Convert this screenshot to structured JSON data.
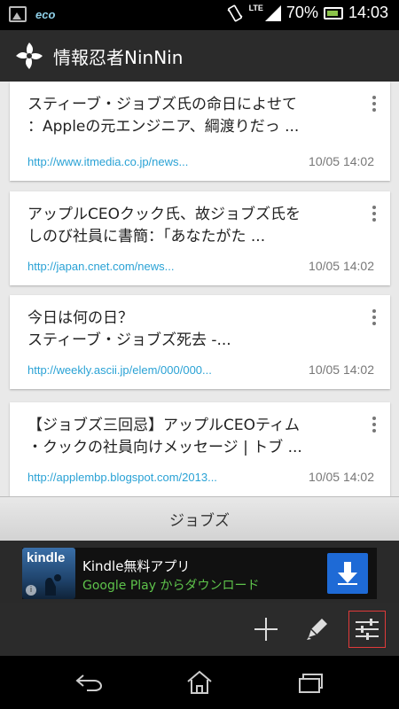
{
  "status_bar": {
    "network": "LTE",
    "battery": "70%",
    "time": "14:03",
    "eco_label": "eco"
  },
  "app": {
    "title": "情報忍者NinNin",
    "logo_icon": "ninja-star-icon"
  },
  "articles": [
    {
      "title": "スティーブ・ジョブズ氏の命日によせて\n：Appleの元エンジニア、綱渡りだっ ...",
      "url": "http://www.itmedia.co.jp/news...",
      "time": "10/05 14:02"
    },
    {
      "title": "アップルCEOクック氏、故ジョブズ氏を\nしのび社員に書簡：「あなたがた ...",
      "url": "http://japan.cnet.com/news...",
      "time": "10/05 14:02"
    },
    {
      "title": "今日は何の日？\nスティーブ・ジョブズ死去 -...",
      "url": "http://weekly.ascii.jp/elem/000/000...",
      "time": "10/05 14:02"
    },
    {
      "title": "【ジョブズ三回忌】アップルCEOティム\n・クックの社員向けメッセージ | トブ ...",
      "url": "http://applembp.blogspot.com/2013...",
      "time": "10/05 14:02"
    }
  ],
  "keyword": {
    "label": "ジョブズ"
  },
  "ad": {
    "icon_text": "kindle",
    "title": "Kindle無料アプリ",
    "subtitle": "Google Play からダウンロード",
    "info_glyph": "i"
  },
  "actions": [
    "add-icon",
    "edit-pencil-icon",
    "settings-sliders-icon"
  ],
  "nav": [
    "back-icon",
    "home-icon",
    "recent-apps-icon"
  ]
}
